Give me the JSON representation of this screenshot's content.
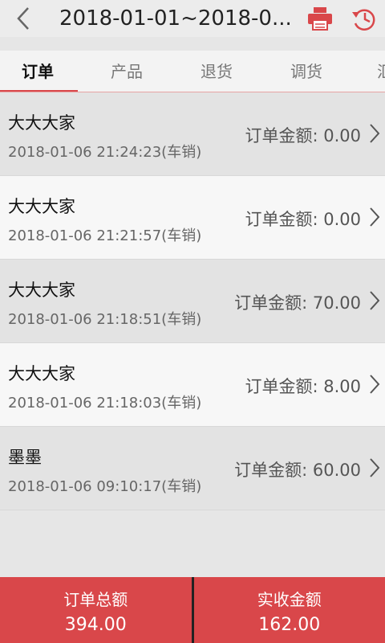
{
  "header": {
    "title": "2018-01-01~2018-0...",
    "icons": [
      "back-chevron-icon",
      "print-icon",
      "history-icon"
    ],
    "accent_color": "#d9474a"
  },
  "tabs": [
    {
      "label": "订单",
      "active": true
    },
    {
      "label": "产品",
      "active": false
    },
    {
      "label": "退货",
      "active": false
    },
    {
      "label": "调货",
      "active": false
    },
    {
      "label": "汇",
      "active": false
    }
  ],
  "orders": [
    {
      "name": "大大大家",
      "time": "2018-01-06 21:24:23(车销)",
      "amount": "订单金额: 0.00"
    },
    {
      "name": "大大大家",
      "time": "2018-01-06 21:21:57(车销)",
      "amount": "订单金额: 0.00"
    },
    {
      "name": "大大大家",
      "time": "2018-01-06 21:18:51(车销)",
      "amount": "订单金额: 70.00"
    },
    {
      "name": "大大大家",
      "time": "2018-01-06 21:18:03(车销)",
      "amount": "订单金额: 8.00"
    },
    {
      "name": "墨墨",
      "time": "2018-01-06 09:10:17(车销)",
      "amount": "订单金额: 60.00"
    }
  ],
  "footer": {
    "total_label": "订单总额",
    "total_value": "394.00",
    "received_label": "实收金额",
    "received_value": "162.00"
  }
}
